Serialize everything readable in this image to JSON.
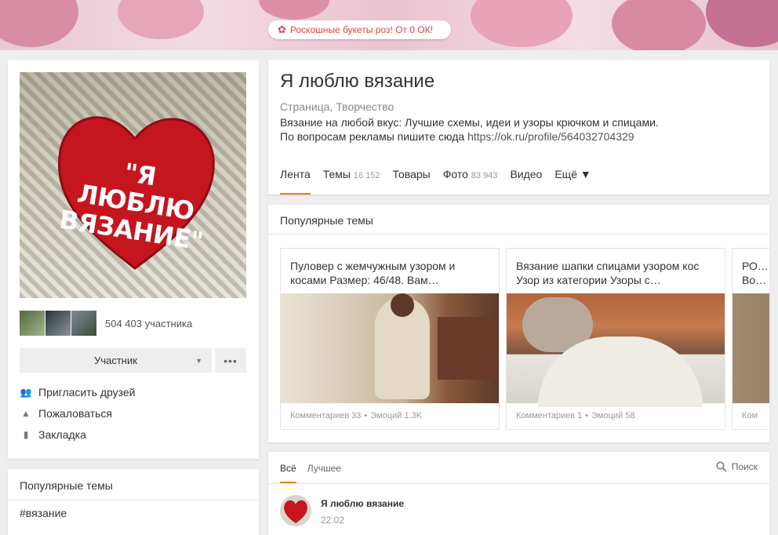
{
  "banner": {
    "ad_text": "Роскошные букеты роз! От 0 ОК!"
  },
  "sidebar": {
    "members_count": "504 403 участника",
    "join_label": "Участник",
    "more_label": "•••",
    "actions": [
      {
        "label": "Пригласить друзей",
        "icon": "people-icon"
      },
      {
        "label": "Пожаловаться",
        "icon": "warning-icon"
      },
      {
        "label": "Закладка",
        "icon": "bookmark-icon"
      }
    ],
    "popular_title": "Популярные темы",
    "popular_tag": "#вязание"
  },
  "avatar_text": "\"Я ЛЮБЛЮ ВЯЗАНИЕ\"",
  "group": {
    "name": "Я люблю вязание",
    "category": "Страница, Творчество",
    "description_line1": "Вязание на любой вкус: Лучшие схемы, идеи и узоры крючком и спицами.",
    "description_line2": "По вопросам рекламы пишите сюда ",
    "ad_link": "https://ok.ru/profile/564032704329",
    "tabs": [
      {
        "label": "Лента",
        "count": ""
      },
      {
        "label": "Темы",
        "count": "16 152"
      },
      {
        "label": "Товары",
        "count": ""
      },
      {
        "label": "Фото",
        "count": "83 943"
      },
      {
        "label": "Видео",
        "count": ""
      },
      {
        "label": "Ещё ▼",
        "count": ""
      }
    ]
  },
  "popular": {
    "title": "Популярные темы",
    "topics": [
      {
        "text": "Пуловер с жемчужным узором и косами Размер: 46/48. Вам…",
        "comments": "Комментариев 33",
        "emotions": "Эмоций 1.3K"
      },
      {
        "text": "Вязание шапки спицами узором кос Узор из категории Узоры с…",
        "comments": "Комментариев 1",
        "emotions": "Эмоций 58"
      },
      {
        "text": "РО… Во…",
        "comments": "Ком",
        "emotions": ""
      }
    ]
  },
  "feed": {
    "tab_all": "Всё",
    "tab_best": "Лучшее",
    "search_label": "Поиск",
    "post_author": "Я люблю вязание",
    "post_time": "22:02"
  },
  "colors": {
    "accent": "#ee8208",
    "ad_red": "#e34242",
    "heart_red": "#c5151f"
  }
}
